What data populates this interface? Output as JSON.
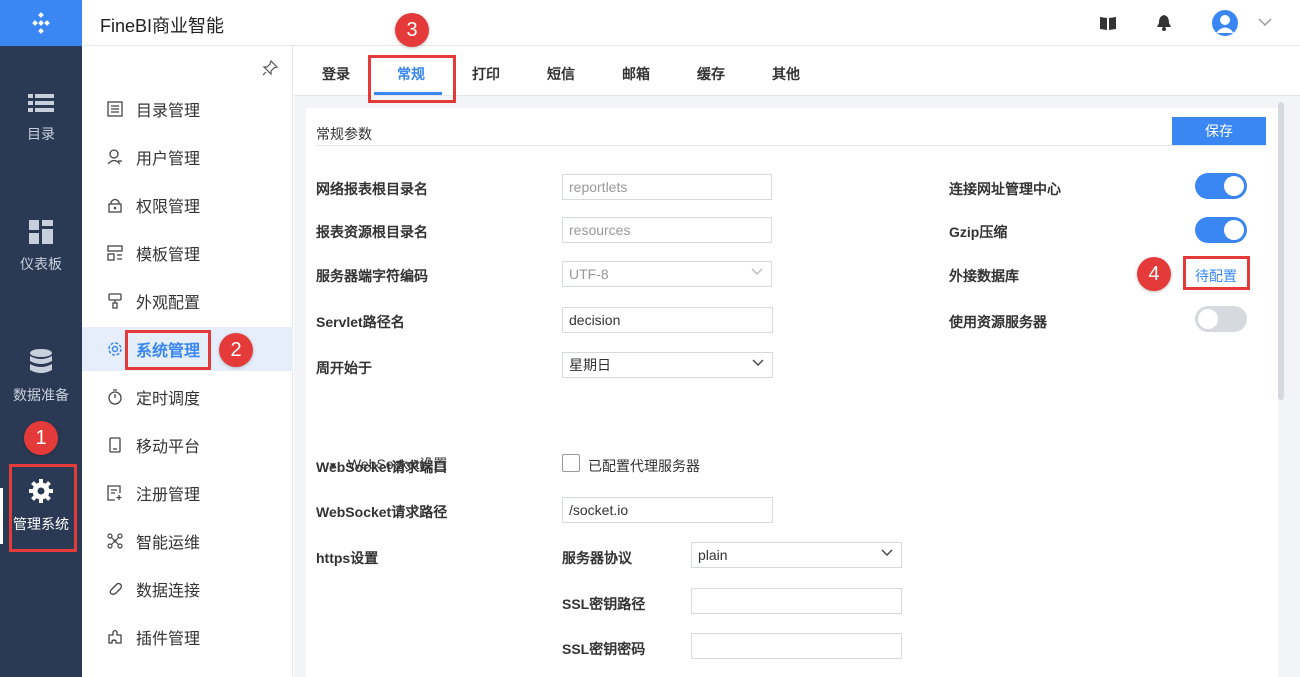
{
  "app": {
    "title": "FineBI商业智能"
  },
  "rail": {
    "items": [
      {
        "label": "目录",
        "icon": "list-icon"
      },
      {
        "label": "仪表板",
        "icon": "dashboard-icon"
      },
      {
        "label": "数据准备",
        "icon": "database-icon"
      },
      {
        "label": "管理系统",
        "icon": "gear-icon",
        "active": true
      }
    ]
  },
  "header": {
    "icons": [
      "book-icon",
      "bell-icon",
      "avatar",
      "chevron-down-icon"
    ]
  },
  "menu": {
    "items": [
      {
        "label": "目录管理",
        "icon": "catalog-icon"
      },
      {
        "label": "用户管理",
        "icon": "user-icon"
      },
      {
        "label": "权限管理",
        "icon": "lock-icon"
      },
      {
        "label": "模板管理",
        "icon": "template-icon"
      },
      {
        "label": "外观配置",
        "icon": "brush-icon"
      },
      {
        "label": "系统管理",
        "icon": "gear-icon",
        "active": true
      },
      {
        "label": "定时调度",
        "icon": "stopwatch-icon"
      },
      {
        "label": "移动平台",
        "icon": "mobile-icon"
      },
      {
        "label": "注册管理",
        "icon": "register-icon"
      },
      {
        "label": "智能运维",
        "icon": "ops-icon"
      },
      {
        "label": "数据连接",
        "icon": "link-icon"
      },
      {
        "label": "插件管理",
        "icon": "plugin-icon"
      }
    ]
  },
  "tabs": [
    "登录",
    "常规",
    "打印",
    "短信",
    "邮箱",
    "缓存",
    "其他"
  ],
  "active_tab": "常规",
  "panel": {
    "title": "常规参数",
    "save_label": "保存",
    "left": [
      {
        "label": "网络报表根目录名",
        "value": "reportlets",
        "disabled": true
      },
      {
        "label": "报表资源根目录名",
        "value": "resources",
        "disabled": true
      },
      {
        "label": "服务器端字符编码",
        "value": "UTF-8",
        "disabled": true,
        "select": true
      },
      {
        "label": "Servlet路径名",
        "value": "decision"
      },
      {
        "label": "周开始于",
        "value": "星期日",
        "select": true
      }
    ],
    "right": [
      {
        "label": "连接网址管理中心",
        "toggle": "on"
      },
      {
        "label": "Gzip压缩",
        "toggle": "on"
      },
      {
        "label": "外接数据库",
        "link": "待配置"
      },
      {
        "label": "使用资源服务器",
        "toggle": "off"
      }
    ],
    "websocket": {
      "section_title": "WebSocket设置",
      "port_label": "WebSocket请求端口",
      "proxy_checkbox_label": "已配置代理服务器",
      "proxy_checked": false,
      "path_label": "WebSocket请求路径",
      "path_value": "/socket.io"
    },
    "https": {
      "label": "https设置",
      "protocol_label": "服务器协议",
      "protocol_value": "plain",
      "ssl_path_label": "SSL密钥路径",
      "ssl_path_value": "",
      "ssl_pass_label": "SSL密钥密码",
      "ssl_pass_value": ""
    }
  },
  "annotations": [
    "1",
    "2",
    "3",
    "4"
  ],
  "colors": {
    "accent": "#3a87f4",
    "rail": "#2a3a54",
    "annotation": "#e43a3a"
  }
}
